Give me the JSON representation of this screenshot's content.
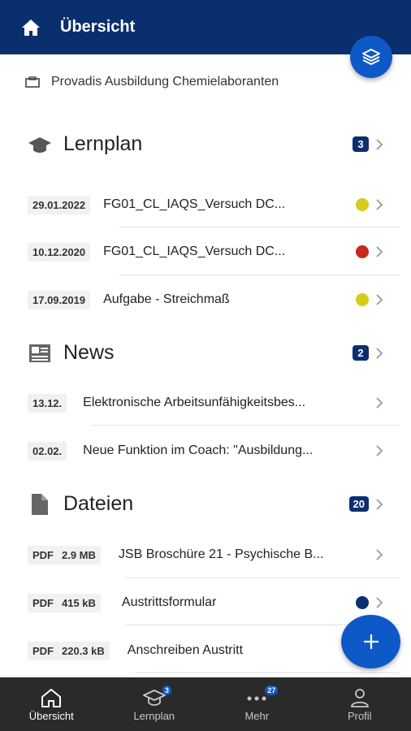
{
  "header": {
    "title": "Übersicht"
  },
  "org": {
    "name": "Provadis Ausbildung Chemielaboranten"
  },
  "lernplan": {
    "title": "Lernplan",
    "count": "3",
    "items": [
      {
        "date": "29.01.2022",
        "label": "FG01_CL_IAQS_Versuch DC...",
        "status_color": "#d4cc1a"
      },
      {
        "date": "10.12.2020",
        "label": "FG01_CL_IAQS_Versuch DC...",
        "status_color": "#c62a1d"
      },
      {
        "date": "17.09.2019",
        "label": "Aufgabe - Streichmaß",
        "status_color": "#d4cc1a"
      }
    ]
  },
  "news": {
    "title": "News",
    "count": "2",
    "items": [
      {
        "date": "13.12.",
        "label": "Elektronische Arbeitsunfähigkeitsbes..."
      },
      {
        "date": "02.02.",
        "label": "Neue Funktion im Coach: \"Ausbildung..."
      }
    ]
  },
  "dateien": {
    "title": "Dateien",
    "count": "20",
    "items": [
      {
        "type": "PDF",
        "size": "2.9 MB",
        "label": "JSB Broschüre 21 - Psychische B..."
      },
      {
        "type": "PDF",
        "size": "415 kB",
        "label": "Austrittsformular",
        "status_color": "#0a2f6e"
      },
      {
        "type": "PDF",
        "size": "220.3 kB",
        "label": "Anschreiben Austritt"
      }
    ]
  },
  "nav": {
    "items": [
      {
        "label": "Übersicht",
        "icon": "home-icon"
      },
      {
        "label": "Lernplan",
        "icon": "graduation-cap-icon",
        "badge": "3"
      },
      {
        "label": "Mehr",
        "icon": "more-dots-icon",
        "badge": "27"
      },
      {
        "label": "Profil",
        "icon": "person-icon"
      }
    ]
  }
}
